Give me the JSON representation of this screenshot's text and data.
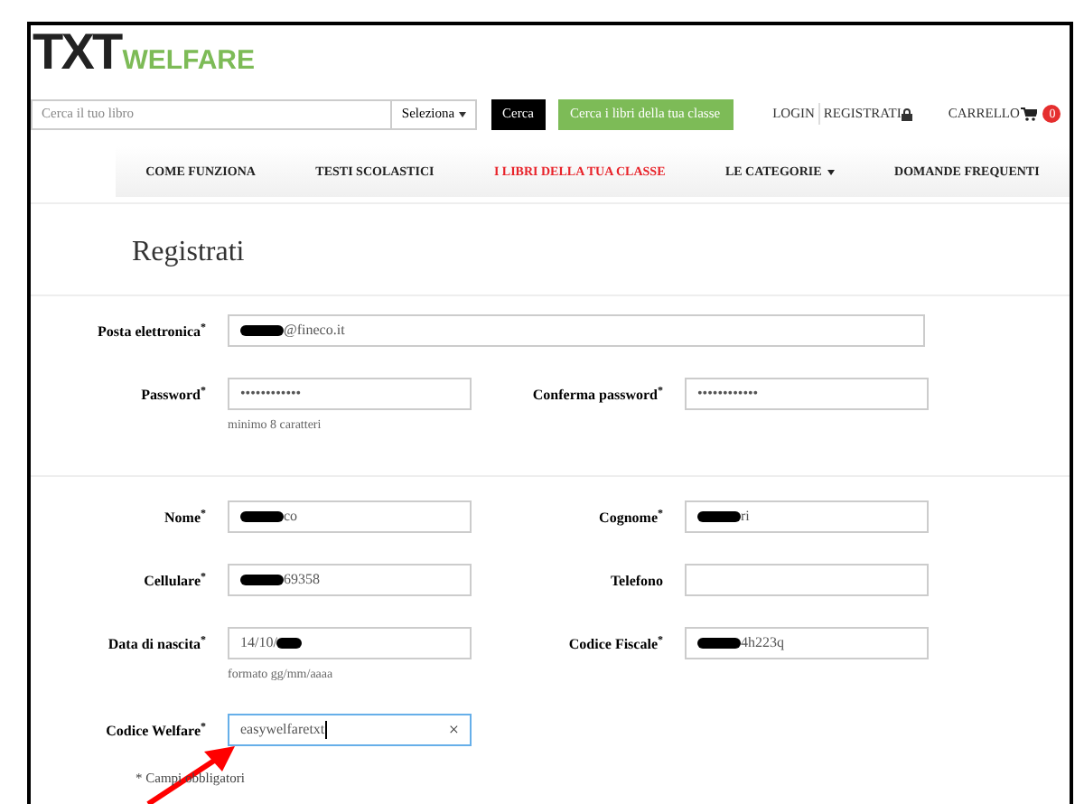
{
  "logo": {
    "mark": "TXT",
    "word": "WELFARE"
  },
  "search": {
    "placeholder": "Cerca il tuo libro",
    "select": "Seleziona",
    "button": "Cerca",
    "class_button": "Cerca i libri della tua classe"
  },
  "account": {
    "login": "LOGIN",
    "register": "REGISTRATI",
    "cart": "CARRELLO",
    "cart_count": "0"
  },
  "nav": [
    {
      "label": "COME FUNZIONA",
      "selected": false,
      "dropdown": false
    },
    {
      "label": "TESTI SCOLASTICI",
      "selected": false,
      "dropdown": false
    },
    {
      "label": "I LIBRI DELLA TUA CLASSE",
      "selected": true,
      "dropdown": false
    },
    {
      "label": "LE CATEGORIE",
      "selected": false,
      "dropdown": true
    },
    {
      "label": "DOMANDE FREQUENTI",
      "selected": false,
      "dropdown": false
    }
  ],
  "page_title": "Registrati",
  "sections": [
    {
      "rows": [
        {
          "fields": [
            {
              "label": "Posta elettronica$^{*}$",
              "value": "@fineco.it",
              "redacted": true,
              "kind": "wide",
              "focused": false
            }
          ]
        },
        {
          "fields": [
            {
              "label": "Password$^{*}$",
              "value": "••••••••••••",
              "hint": "minimo 8 caratteri",
              "focused": false
            },
            {
              "label": "Conferma password$^{*}$",
              "value": "••••••••••••",
              "focused": false
            }
          ]
        }
      ]
    },
    {
      "rows": [
        {
          "fields": [
            {
              "label": "Nome$^{*}$",
              "value": "co",
              "redacted": true,
              "focused": false
            },
            {
              "label": "Cognome$^{*}$",
              "value": "ri",
              "redacted": true,
              "focused": false
            }
          ]
        },
        {
          "fields": [
            {
              "label": "Cellulare$^{*}$",
              "value": "69358",
              "redacted": true,
              "focused": false
            },
            {
              "label": "Telefono",
              "focused": false
            }
          ]
        },
        {
          "fields": [
            {
              "label": "Data di nascita$^{*}$",
              "value": "14/10/",
              "redacted": true,
              "redacted_at_end": true,
              "hint": "formato gg/mm/aaaa",
              "focused": false
            },
            {
              "label": "Codice Fiscale$^{*}$",
              "value": "4h223q",
              "redacted": true,
              "focused": false
            }
          ]
        },
        {
          "fields": [
            {
              "label": "Codice Welfare$^{*}$",
              "value": "easywelfaretxt",
              "focused": true,
              "clear": "×"
            }
          ]
        }
      ]
    }
  ],
  "required_note": "* Campi obbligatori"
}
